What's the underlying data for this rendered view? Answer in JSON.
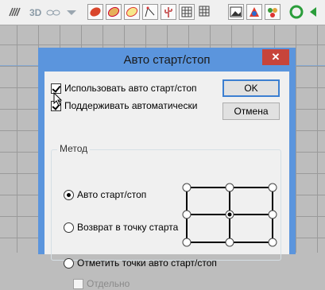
{
  "toolbar": {
    "label_3d": "3D",
    "icons": [
      "brush-icon",
      "3d-label",
      "glasses-icon",
      "dropdown-icon",
      "red-ellipse-icon",
      "hatched-ellipse-icon",
      "yellow-ellipse-icon",
      "polyline-icon",
      "cactus-icon",
      "grid-icon",
      "grid-icon-2",
      "picture-icon",
      "paint-icon",
      "leaves-icon",
      "green-circle-icon",
      "green-arrow-icon"
    ]
  },
  "dialog": {
    "title": "Авто старт/стоп",
    "close": "✕",
    "checkbox_use": "Использовать авто старт/стоп",
    "checkbox_support": "Поддерживать автоматически",
    "ok": "OK",
    "cancel": "Отмена",
    "group_label": "Метод",
    "radio_auto": "Авто старт/стоп",
    "radio_return": "Возврат в точку старта",
    "radio_mark": "Отметить точки авто старт/стоп",
    "checkbox_separate": "Отдельно"
  }
}
